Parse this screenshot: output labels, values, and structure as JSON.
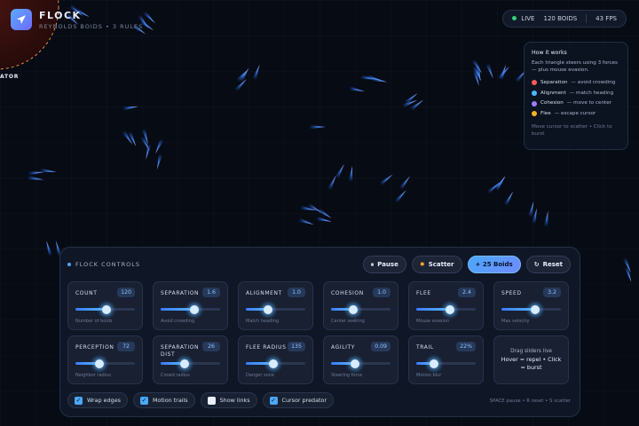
{
  "app": {
    "title": "FLOCK",
    "subtitle": "REYNOLDS BOIDS • 3 RULES",
    "predator_label": "ATOR"
  },
  "status": {
    "live": "LIVE",
    "boids": "120 BOIDS",
    "fps": "43 FPS"
  },
  "info": {
    "title": "How it works",
    "description": "Each triangle steers using 3 forces — plus mouse evasion.",
    "rules": [
      {
        "name": "Separation",
        "desc": "— avoid crowding",
        "color": "#ff5a5a"
      },
      {
        "name": "Alignment",
        "desc": "— match heading",
        "color": "#4ab8ff"
      },
      {
        "name": "Cohesion",
        "desc": "— move to center",
        "color": "#a07bff"
      },
      {
        "name": "Flee",
        "desc": "— escape cursor",
        "color": "#ffb020"
      }
    ],
    "hint": "Move cursor to scatter • Click to burst"
  },
  "controls": {
    "title": "FLOCK CONTROLS",
    "buttons": {
      "pause": "Pause",
      "scatter": "Scatter",
      "add_boids": "+ 25 Boids",
      "reset": "Reset"
    },
    "sliders": [
      {
        "label": "COUNT",
        "value": "120",
        "hint": "Number of boids",
        "level": 0.52
      },
      {
        "label": "SEPARATION",
        "value": "1.6",
        "hint": "Avoid crowding",
        "level": 0.56
      },
      {
        "label": "ALIGNMENT",
        "value": "1.0",
        "hint": "Match heading",
        "level": 0.38
      },
      {
        "label": "COHESION",
        "value": "1.0",
        "hint": "Center seeking",
        "level": 0.38
      },
      {
        "label": "FLEE",
        "value": "2.4",
        "hint": "Mouse evasion",
        "level": 0.56
      },
      {
        "label": "SPEED",
        "value": "3.2",
        "hint": "Max velocity",
        "level": 0.56
      },
      {
        "label": "PERCEPTION",
        "value": "72",
        "hint": "Neighbor radius",
        "level": 0.4
      },
      {
        "label": "SEPARATION DIST",
        "value": "26",
        "hint": "Crowd radius",
        "level": 0.4
      },
      {
        "label": "FLEE RADIUS",
        "value": "135",
        "hint": "Danger zone",
        "level": 0.46
      },
      {
        "label": "AGILITY",
        "value": "0.09",
        "hint": "Steering force",
        "level": 0.4
      },
      {
        "label": "TRAIL",
        "value": "22%",
        "hint": "Motion blur",
        "level": 0.3
      }
    ],
    "tip": {
      "title": "Drag sliders live",
      "body": "Hover = repel • Click = burst"
    },
    "toggles": [
      {
        "label": "Wrap edges",
        "checked": true
      },
      {
        "label": "Motion trails",
        "checked": true
      },
      {
        "label": "Show links",
        "checked": false
      },
      {
        "label": "Cursor predator",
        "checked": true
      }
    ],
    "shortcuts": "SPACE pause • R reset • S scatter"
  }
}
